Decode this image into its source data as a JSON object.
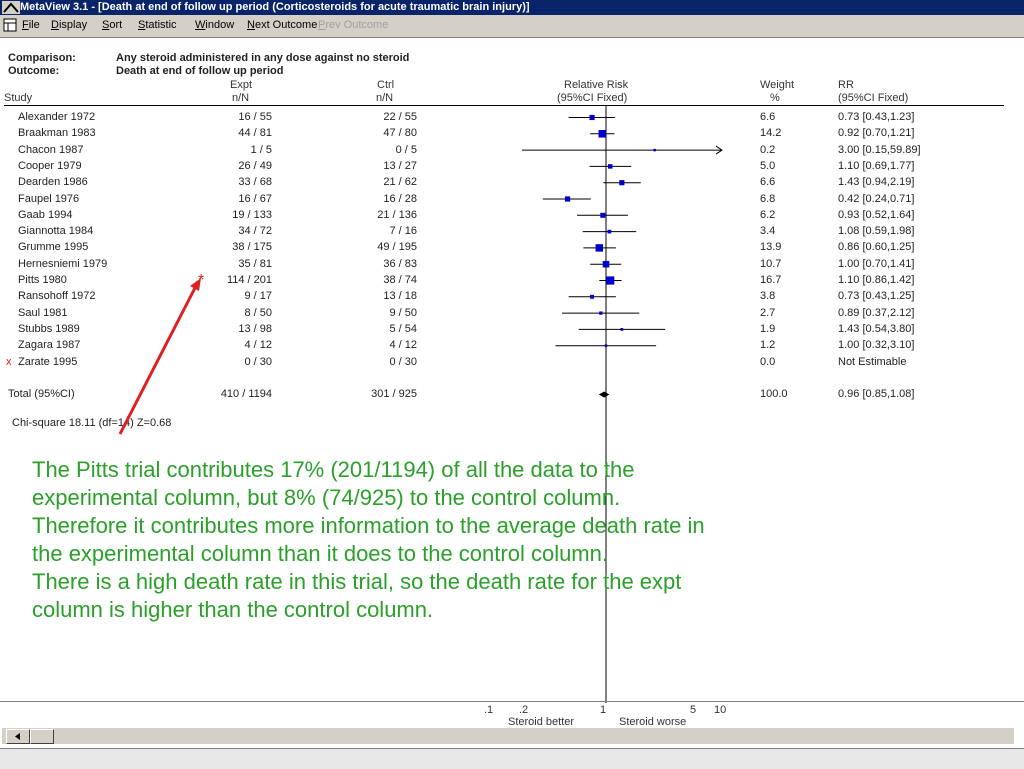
{
  "window": {
    "title": "MetaView 3.1 - [Death at end of follow up period (Corticosteroids for acute traumatic brain injury)]"
  },
  "menu": {
    "items": [
      {
        "label": "File",
        "enabled": true
      },
      {
        "label": "Display",
        "enabled": true
      },
      {
        "label": "Sort",
        "enabled": true
      },
      {
        "label": "Statistic",
        "enabled": true
      },
      {
        "label": "Window",
        "enabled": true
      },
      {
        "label": "Next Outcome",
        "enabled": true
      },
      {
        "label": "Prev Outcome",
        "enabled": false
      }
    ]
  },
  "header": {
    "comparison_label": "Comparison:",
    "comparison_value": "Any steroid administered in any dose against no steroid",
    "outcome_label": "Outcome:",
    "outcome_value": "Death at end of follow up period",
    "col_study": "Study",
    "col_expt_top": "Expt",
    "col_expt_bottom": "n/N",
    "col_ctrl_top": "Ctrl",
    "col_ctrl_bottom": "n/N",
    "col_rr_top": "Relative Risk",
    "col_rr_bottom": "(95%CI Fixed)",
    "col_weight_top": "Weight",
    "col_weight_bottom": "%",
    "col_rrval_top": "RR",
    "col_rrval_bottom": "(95%CI Fixed)"
  },
  "studies": [
    {
      "study": "Alexander 1972",
      "expt": "16 / 55",
      "ctrl": "22 / 55",
      "weight": "6.6",
      "rr_text": "0.73 [0.43,1.23]",
      "rr": 0.73,
      "lo": 0.43,
      "hi": 1.23,
      "w": 6.6
    },
    {
      "study": "Braakman 1983",
      "expt": "44 / 81",
      "ctrl": "47 / 80",
      "weight": "14.2",
      "rr_text": "0.92 [0.70,1.21]",
      "rr": 0.92,
      "lo": 0.7,
      "hi": 1.21,
      "w": 14.2
    },
    {
      "study": "Chacon 1987",
      "expt": "1 / 5",
      "ctrl": "0 / 5",
      "weight": "0.2",
      "rr_text": "3.00 [0.15,59.89]",
      "rr": 3.0,
      "lo": 0.15,
      "hi": 59.89,
      "w": 0.2
    },
    {
      "study": "Cooper 1979",
      "expt": "26 / 49",
      "ctrl": "13 / 27",
      "weight": "5.0",
      "rr_text": "1.10 [0.69,1.77]",
      "rr": 1.1,
      "lo": 0.69,
      "hi": 1.77,
      "w": 5.0
    },
    {
      "study": "Dearden 1986",
      "expt": "33 / 68",
      "ctrl": "21 / 62",
      "weight": "6.6",
      "rr_text": "1.43 [0.94,2.19]",
      "rr": 1.43,
      "lo": 0.94,
      "hi": 2.19,
      "w": 6.6
    },
    {
      "study": "Faupel 1976",
      "expt": "16 / 67",
      "ctrl": "16 / 28",
      "weight": "6.8",
      "rr_text": "0.42 [0.24,0.71]",
      "rr": 0.42,
      "lo": 0.24,
      "hi": 0.71,
      "w": 6.8
    },
    {
      "study": "Gaab 1994",
      "expt": "19 / 133",
      "ctrl": "21 / 136",
      "weight": "6.2",
      "rr_text": "0.93 [0.52,1.64]",
      "rr": 0.93,
      "lo": 0.52,
      "hi": 1.64,
      "w": 6.2
    },
    {
      "study": "Giannotta 1984",
      "expt": "34 / 72",
      "ctrl": "7 / 16",
      "weight": "3.4",
      "rr_text": "1.08 [0.59,1.98]",
      "rr": 1.08,
      "lo": 0.59,
      "hi": 1.98,
      "w": 3.4
    },
    {
      "study": "Grumme 1995",
      "expt": "38 / 175",
      "ctrl": "49 / 195",
      "weight": "13.9",
      "rr_text": "0.86 [0.60,1.25]",
      "rr": 0.86,
      "lo": 0.6,
      "hi": 1.25,
      "w": 13.9
    },
    {
      "study": "Hernesniemi 1979",
      "expt": "35 / 81",
      "ctrl": "36 / 83",
      "weight": "10.7",
      "rr_text": "1.00 [0.70,1.41]",
      "rr": 1.0,
      "lo": 0.7,
      "hi": 1.41,
      "w": 10.7
    },
    {
      "study": "Pitts 1980",
      "expt": "114 / 201",
      "ctrl": "38 / 74",
      "weight": "16.7",
      "rr_text": "1.10 [0.86,1.42]",
      "rr": 1.1,
      "lo": 0.86,
      "hi": 1.42,
      "w": 16.7,
      "starred": true
    },
    {
      "study": "Ransohoff 1972",
      "expt": "9 / 17",
      "ctrl": "13 / 18",
      "weight": "3.8",
      "rr_text": "0.73 [0.43,1.25]",
      "rr": 0.73,
      "lo": 0.43,
      "hi": 1.25,
      "w": 3.8
    },
    {
      "study": "Saul 1981",
      "expt": "8 / 50",
      "ctrl": "9 / 50",
      "weight": "2.7",
      "rr_text": "0.89 [0.37,2.12]",
      "rr": 0.89,
      "lo": 0.37,
      "hi": 2.12,
      "w": 2.7
    },
    {
      "study": "Stubbs 1989",
      "expt": "13 / 98",
      "ctrl": "5 / 54",
      "weight": "1.9",
      "rr_text": "1.43 [0.54,3.80]",
      "rr": 1.43,
      "lo": 0.54,
      "hi": 3.8,
      "w": 1.9
    },
    {
      "study": "Zagara 1987",
      "expt": "4 / 12",
      "ctrl": "4 / 12",
      "weight": "1.2",
      "rr_text": "1.00 [0.32,3.10]",
      "rr": 1.0,
      "lo": 0.32,
      "hi": 3.1,
      "w": 1.2
    },
    {
      "study": "Zarate 1995",
      "expt": "0 / 30",
      "ctrl": "0 / 30",
      "weight": "0.0",
      "rr_text": "Not Estimable",
      "rr": null,
      "lo": null,
      "hi": null,
      "w": 0.0,
      "excluded": true
    }
  ],
  "total": {
    "study": "Total (95%CI)",
    "expt": "410 / 1194",
    "ctrl": "301 / 925",
    "weight": "100.0",
    "rr_text": "0.96 [0.85,1.08]",
    "rr": 0.96,
    "lo": 0.85,
    "hi": 1.08
  },
  "chisq_text": "Chi-square 18.11 (df=14)  Z=0.68",
  "annotation": {
    "lines": [
      "The Pitts trial contributes 17% (201/1194) of all the data to the",
      "experimental column, but 8% (74/925) to the control column.",
      "Therefore it contributes more information to the average death rate in",
      "the experimental column than it does to the control column.",
      "There is a high death rate in this trial, so the death rate for the expt",
      "column is higher than the control column."
    ],
    "color": "#2aa02a",
    "marker_symbol": "*",
    "excluded_marker": "x"
  },
  "scale": {
    "ticks": [
      ".1",
      ".2",
      "1",
      "5",
      "10"
    ],
    "left_label": "Steroid better",
    "right_label": "Steroid worse"
  },
  "colors": {
    "titlebar": "#0a246a",
    "marker": "#0000cc",
    "arrow": "#e02020"
  }
}
